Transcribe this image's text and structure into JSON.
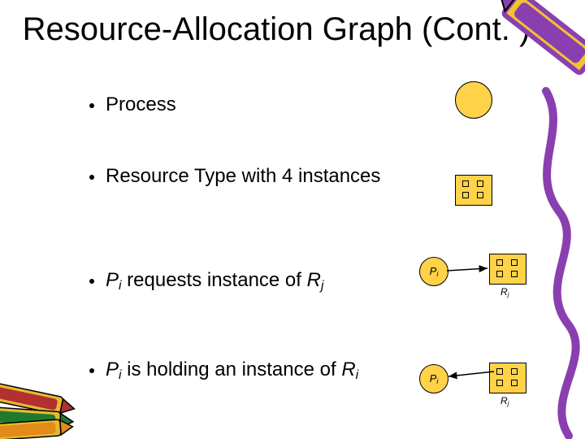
{
  "title": "Resource-Allocation Graph (Cont. )",
  "bullets": {
    "b1": "Process",
    "b2": "Resource Type with 4 instances",
    "b3_pre": "P",
    "b3_sub1": "i",
    "b3_mid": " requests instance of ",
    "b3_r": "R",
    "b3_sub2": "j",
    "b4_pre": "P",
    "b4_sub1": "i",
    "b4_mid": " is holding an instance of ",
    "b4_r": "R",
    "b4_sub2": "i"
  },
  "labels": {
    "p": "P",
    "pi": "i",
    "r": "R",
    "rj": "j"
  }
}
